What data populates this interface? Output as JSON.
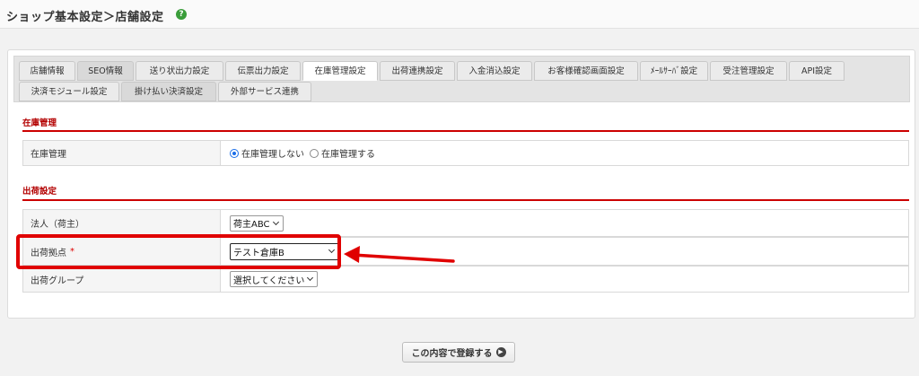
{
  "header": {
    "title": "ショップ基本設定＞店舗設定",
    "help_icon": "?"
  },
  "tabs_row1": [
    {
      "label": "店舗情報"
    },
    {
      "label": "SEO情報"
    },
    {
      "label": "送り状出力設定"
    },
    {
      "label": "伝票出力設定"
    },
    {
      "label": "在庫管理設定",
      "active": true
    },
    {
      "label": "出荷連携設定"
    },
    {
      "label": "入金消込設定"
    },
    {
      "label": "お客様確認画面設定"
    },
    {
      "label": "ﾒｰﾙｻｰﾊﾞ設定"
    },
    {
      "label": "受注管理設定"
    },
    {
      "label": "API設定"
    }
  ],
  "tabs_row2": [
    {
      "label": "決済モジュール設定"
    },
    {
      "label": "掛け払い決済設定"
    },
    {
      "label": "外部サービス連携"
    }
  ],
  "stock_section": {
    "title": "在庫管理",
    "row_label": "在庫管理",
    "options": [
      "在庫管理しない",
      "在庫管理する"
    ],
    "selected": "在庫管理しない"
  },
  "shipping_section": {
    "title": "出荷設定",
    "corporation": {
      "label": "法人（荷主）",
      "value": "荷主ABC"
    },
    "location": {
      "label": "出荷拠点",
      "required_mark": "*",
      "value": "テスト倉庫B"
    },
    "group": {
      "label": "出荷グループ",
      "value": "選択してください"
    }
  },
  "footer": {
    "submit_label": "この内容で登録する"
  },
  "colors": {
    "accent_red": "#cc0000",
    "annotation_red": "#e00000",
    "radio_blue": "#1a6ee8",
    "help_green": "#3a9d3a"
  }
}
